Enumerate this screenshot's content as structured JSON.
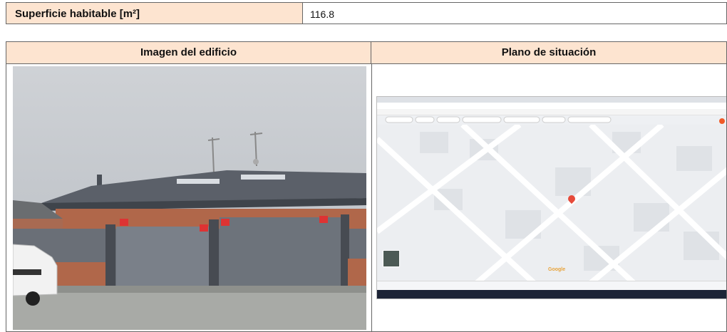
{
  "summary": {
    "label": "Superficie habitable [m²]",
    "value": "116.8"
  },
  "table": {
    "col1_header": "Imagen del edificio",
    "col2_header": "Plano de situación"
  },
  "map": {
    "watermark": "Google"
  },
  "colors": {
    "header_bg": "#fde4d0",
    "border": "#666666",
    "map_pin": "#e64a3a"
  }
}
